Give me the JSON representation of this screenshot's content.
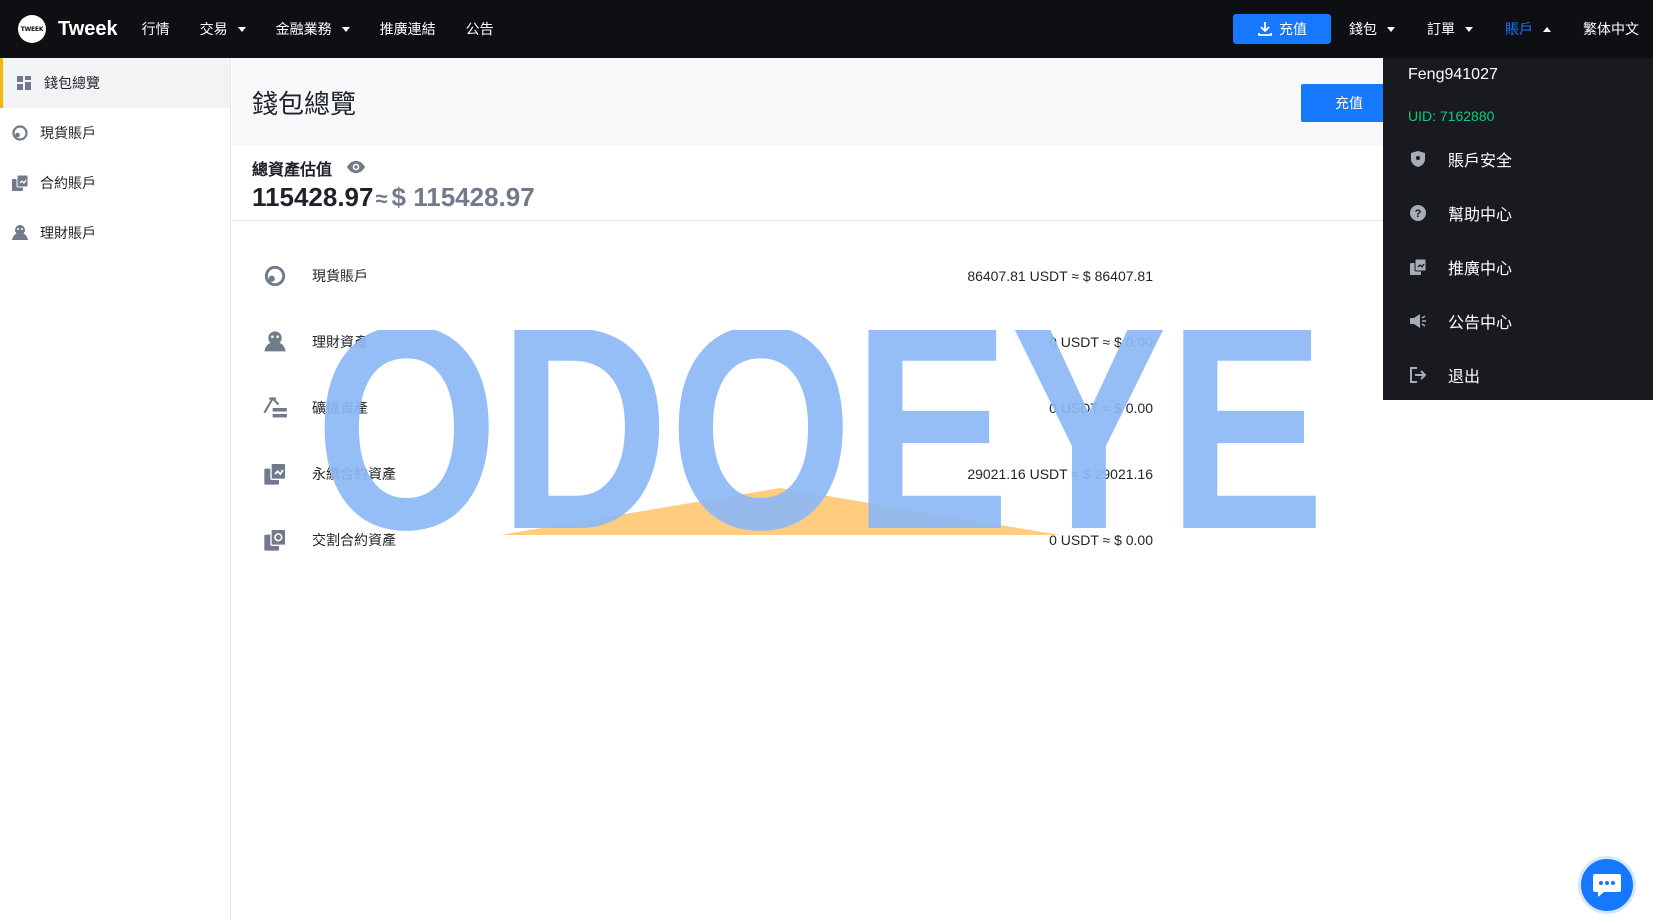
{
  "topbar": {
    "logo_mark": "TWEEK",
    "brand": "Tweek",
    "nav": [
      {
        "label": "行情",
        "dropdown": false
      },
      {
        "label": "交易",
        "dropdown": true
      },
      {
        "label": "金融業務",
        "dropdown": true
      },
      {
        "label": "推廣連結",
        "dropdown": false
      },
      {
        "label": "公告",
        "dropdown": false
      }
    ],
    "deposit_label": "充值",
    "wallet_label": "錢包",
    "orders_label": "訂單",
    "account_label": "賬戶",
    "language_label": "繁体中文"
  },
  "sidebar": {
    "items": [
      {
        "label": "錢包總覽",
        "icon": "grid-icon",
        "active": true
      },
      {
        "label": "現貨賬戶",
        "icon": "spot-icon",
        "active": false
      },
      {
        "label": "合約賬戶",
        "icon": "contract-icon",
        "active": false
      },
      {
        "label": "理財賬戶",
        "icon": "finance-icon",
        "active": false
      }
    ]
  },
  "main": {
    "title": "錢包總覽",
    "deposit_label": "充值",
    "total_label": "總資產估值",
    "total_value": "115428.97",
    "approx": "≈",
    "total_usd": "$ 115428.97",
    "assets": [
      {
        "name": "現貨賬戶",
        "value": "86407.81 USDT ≈ $ 86407.81",
        "icon": "spot-icon"
      },
      {
        "name": "理財資產",
        "value": "0 USDT ≈ $ 0.00",
        "icon": "finance-icon"
      },
      {
        "name": "礦機資產",
        "value": "0 USDT ≈ $ 0.00",
        "icon": "mining-icon"
      },
      {
        "name": "永續合約資產",
        "value": "29021.16 USDT ≈ $ 29021.16",
        "icon": "perpetual-icon"
      },
      {
        "name": "交割合約資產",
        "value": "0 USDT ≈ $ 0.00",
        "icon": "delivery-icon"
      }
    ]
  },
  "account_menu": {
    "username": "Feng941027",
    "uid": "UID: 7162880",
    "items": [
      {
        "label": "賬戶安全",
        "icon": "shield-icon"
      },
      {
        "label": "幫助中心",
        "icon": "help-icon"
      },
      {
        "label": "推廣中心",
        "icon": "promo-icon"
      },
      {
        "label": "公告中心",
        "icon": "megaphone-icon"
      },
      {
        "label": "退出",
        "icon": "logout-icon"
      }
    ]
  },
  "watermark": {
    "text": "ODOEYE"
  },
  "colors": {
    "topbar_bg": "#0e0f12",
    "accent": "#1677ff",
    "sidebar_active_bar": "#f0b90b",
    "uid_green": "#0ecb81",
    "watermark_blue": "#8db8f5",
    "watermark_orange": "#ffcc80"
  }
}
